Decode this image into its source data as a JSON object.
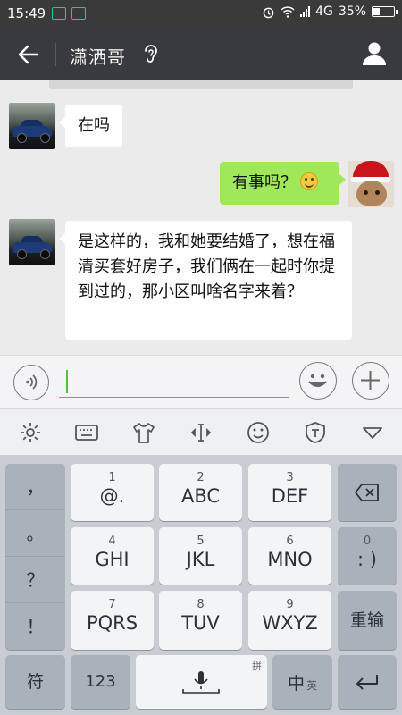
{
  "status_bar": {
    "time": "15:49",
    "network": "4G",
    "battery": "35%",
    "battery_level": 0.35
  },
  "header": {
    "title": "潇洒哥"
  },
  "messages": [
    {
      "side": "left",
      "text": "在吗"
    },
    {
      "side": "right",
      "text": "有事吗？"
    },
    {
      "side": "left",
      "text": "是这样的，我和她要结婚了，想在福清买套好房子，我们俩在一起时你提到过的，那小区叫啥名字来着？"
    }
  ],
  "keyboard": {
    "punct_keys": [
      "，",
      "。",
      "？",
      "！"
    ],
    "keys": [
      {
        "num": "1",
        "label": "@."
      },
      {
        "num": "2",
        "label": "ABC"
      },
      {
        "num": "3",
        "label": "DEF"
      },
      {
        "num": "4",
        "label": "GHI"
      },
      {
        "num": "5",
        "label": "JKL"
      },
      {
        "num": "6",
        "label": "MNO"
      },
      {
        "num": "7",
        "label": "PQRS"
      },
      {
        "num": "8",
        "label": "TUV"
      },
      {
        "num": "9",
        "label": "WXYZ"
      }
    ],
    "zero_key": {
      "num": "0",
      "label": ": )"
    },
    "retype_label": "重输",
    "symbol_label": "符",
    "num_label": "123",
    "space_hint": "拼",
    "lang_main": "中",
    "lang_sub": "英"
  },
  "colors": {
    "header_bg": "#393a3f",
    "bubble_right": "#9fe85a",
    "accent_green": "#58be3f"
  }
}
